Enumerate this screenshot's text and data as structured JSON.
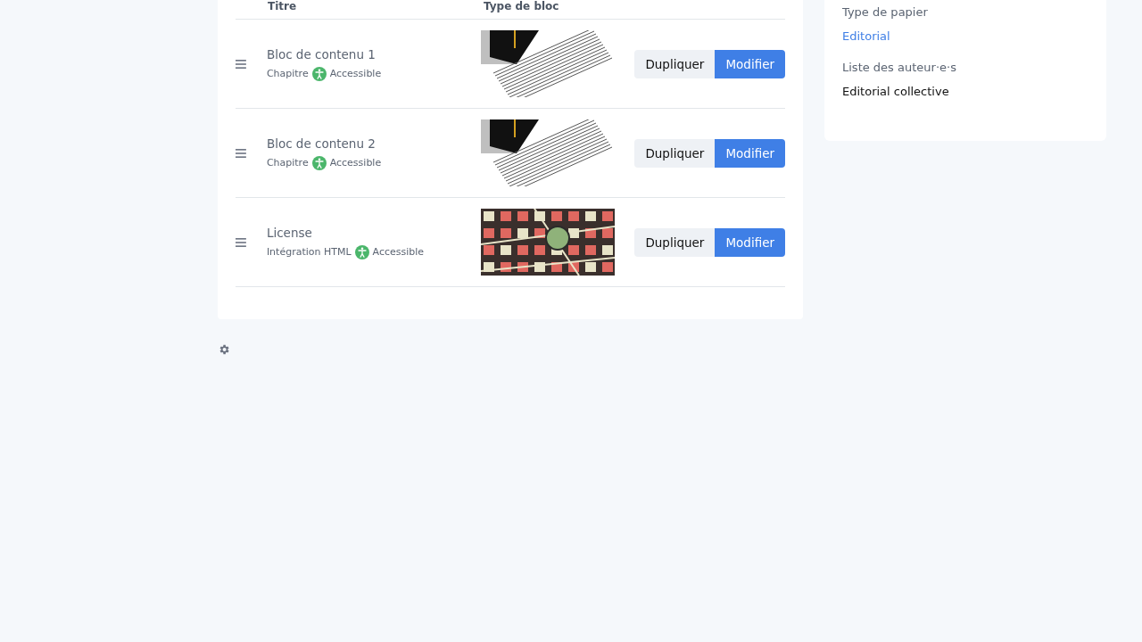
{
  "table": {
    "columns": [
      "Titre",
      "Type de bloc"
    ],
    "rows": [
      {
        "title": "Bloc de contenu 1",
        "type": "Chapitre",
        "accessible": true,
        "accessible_label": "Accessible",
        "kind": "document",
        "actions": [
          "Dupliquer",
          "Modifier"
        ]
      },
      {
        "title": "Bloc de contenu 2",
        "type": "Chapitre",
        "accessible": true,
        "accessible_label": "Accessible",
        "kind": "document",
        "actions": [
          "Dupliquer",
          "Modifier"
        ]
      },
      {
        "title": "License",
        "type": "Intégration HTML",
        "accessible": true,
        "accessible_label": "Accessible",
        "kind": "map",
        "actions": [
          "Dupliquer",
          "Modifier"
        ]
      }
    ]
  },
  "sidebar": {
    "fields": [
      {
        "label": "Type de papier",
        "value": "Editorial",
        "link": true
      },
      {
        "label": "Liste des auteur·e·s",
        "value": "Editorial collective",
        "link": false
      }
    ]
  }
}
